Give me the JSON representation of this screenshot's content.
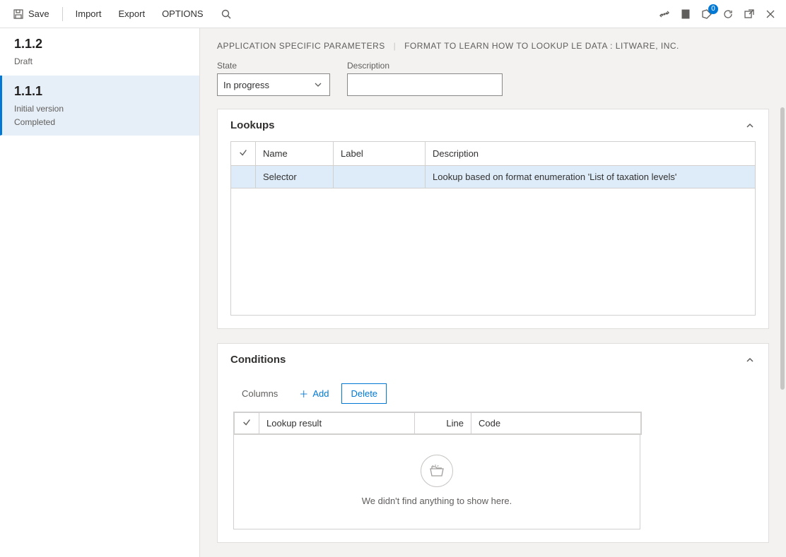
{
  "toolbar": {
    "save": "Save",
    "import": "Import",
    "export": "Export",
    "options": "OPTIONS",
    "notif_count": "0"
  },
  "sidebar": {
    "items": [
      {
        "version": "1.1.2",
        "line1": "Draft",
        "line2": ""
      },
      {
        "version": "1.1.1",
        "line1": "Initial version",
        "line2": "Completed"
      }
    ]
  },
  "header": {
    "crumb1": "APPLICATION SPECIFIC PARAMETERS",
    "crumb2": "FORMAT TO LEARN HOW TO LOOKUP LE DATA : LITWARE, INC."
  },
  "fields": {
    "state_label": "State",
    "state_value": "In progress",
    "description_label": "Description",
    "description_value": ""
  },
  "lookups": {
    "title": "Lookups",
    "columns": {
      "name": "Name",
      "label": "Label",
      "description": "Description"
    },
    "rows": [
      {
        "name": "Selector",
        "label": "",
        "description": "Lookup based on format enumeration 'List of taxation levels'"
      }
    ]
  },
  "conditions": {
    "title": "Conditions",
    "toolbar": {
      "columns": "Columns",
      "add": "Add",
      "delete": "Delete"
    },
    "columns": {
      "lookup_result": "Lookup result",
      "line": "Line",
      "code": "Code"
    },
    "empty_msg": "We didn't find anything to show here."
  }
}
